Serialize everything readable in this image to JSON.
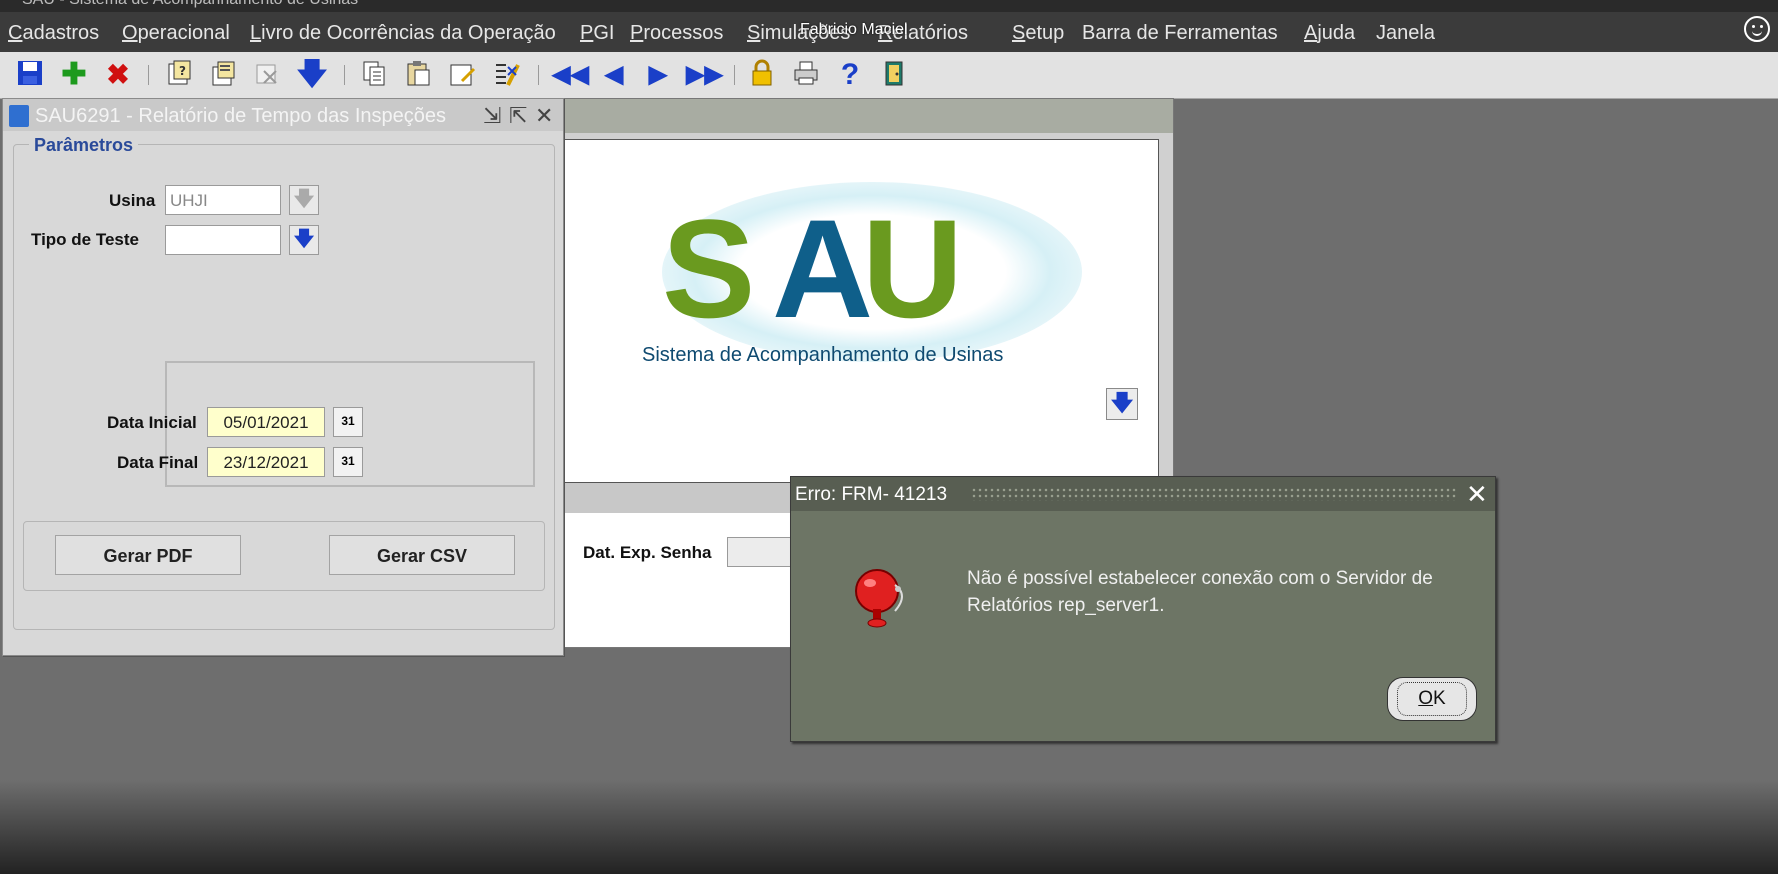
{
  "app": {
    "title_strip": "SAU - Sistema de Acompanhamento de Usinas",
    "user": "Fabricio Maciel"
  },
  "menu": [
    {
      "first": "C",
      "rest": "adastros"
    },
    {
      "first": "O",
      "rest": "peracional"
    },
    {
      "first": "L",
      "rest": "ivro de Ocorrências da Operação"
    },
    {
      "first": "P",
      "rest": "GI"
    },
    {
      "first": "P",
      "rest": "rocessos"
    },
    {
      "first": "S",
      "rest": "imulações"
    },
    {
      "first": "R",
      "rest": "elatórios"
    },
    {
      "first": "S",
      "rest": "etup"
    },
    {
      "first": "",
      "rest": "Barra de Ferramentas"
    },
    {
      "first": "A",
      "rest": "juda"
    },
    {
      "first": "",
      "rest": "Janela"
    }
  ],
  "toolbar_icons": [
    "save-icon",
    "add-record-icon",
    "delete-record-icon",
    "query-icon",
    "execute-query-icon",
    "cancel-query-icon",
    "down-arrow-icon",
    "copy-icon",
    "paste-icon",
    "edit-icon",
    "clear-icon",
    "first-record-icon",
    "previous-record-icon",
    "next-record-icon",
    "last-record-icon",
    "lock-icon",
    "print-icon",
    "help-icon",
    "exit-icon"
  ],
  "form": {
    "title": "SAU6291 - Relatório de Tempo das Inspeções",
    "group_label": "Parâmetros",
    "usina_label": "Usina",
    "usina_value": "UHJI",
    "tipo_teste_label": "Tipo de Teste",
    "tipo_teste_value": "",
    "data_inicial_label": "Data Inicial",
    "data_inicial_value": "05/01/2021",
    "data_final_label": "Data Final",
    "data_final_value": "23/12/2021",
    "calendar_text": "31",
    "gerar_pdf": "Gerar PDF",
    "gerar_csv": "Gerar CSV"
  },
  "background_window": {
    "logo_letters": [
      "S",
      "A",
      "U"
    ],
    "logo_subtitle": "Sistema de Acompanhamento de Usinas",
    "dat_exp_senha_label": "Dat. Exp. Senha"
  },
  "dialog": {
    "title": "Erro: FRM- 41213",
    "message": "Não é possível estabelecer conexão com o Servidor de Relatórios rep_server1.",
    "ok_first": "O",
    "ok_rest": "K"
  },
  "colors": {
    "logo_green": "#6a9a1f",
    "logo_blue": "#0f5f8a",
    "accent_blue": "#1a3fc8",
    "dialog_bg": "#6d7565"
  }
}
